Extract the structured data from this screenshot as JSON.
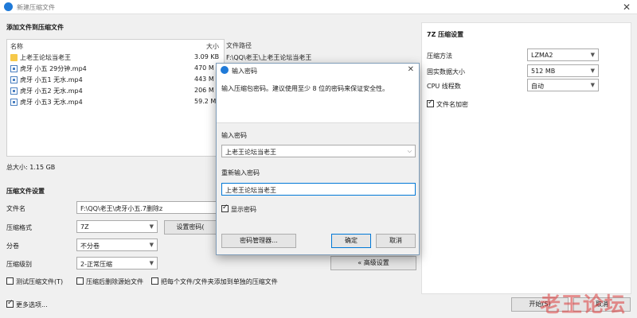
{
  "window": {
    "title": "新建压缩文件",
    "close": "✕"
  },
  "files_section": {
    "heading": "添加文件到压缩文件",
    "columns": [
      "名称",
      "大小",
      "文件路径"
    ],
    "rows": [
      {
        "name": "上老王论坛当老王",
        "size": "3.09 KB",
        "path": "F:\\QQ\\老王\\上老王论坛当老王",
        "type": "folder"
      },
      {
        "name": "虎牙 小五 29分钟.mp4",
        "size": "470 M",
        "path": "",
        "type": "video"
      },
      {
        "name": "虎牙 小五1 无水.mp4",
        "size": "443 M",
        "path": "",
        "type": "video"
      },
      {
        "name": "虎牙 小五2 无水.mp4",
        "size": "206 M",
        "path": "",
        "type": "video"
      },
      {
        "name": "虎牙 小五3 无水.mp4",
        "size": "59.2 M",
        "path": "",
        "type": "video"
      }
    ],
    "total": "总大小: 1.15 GB"
  },
  "settings": {
    "heading": "压缩文件设置",
    "filename_label": "文件名",
    "filename_value": "F:\\QQ\\老王\\虎牙小五.7删除z",
    "format_label": "压缩格式",
    "format_value": "7Z",
    "password_btn": "设置密码(",
    "split_label": "分卷",
    "split_value": "不分卷",
    "level_label": "压缩级别",
    "level_value": "2-正常压缩",
    "advanced_btn": "« 高级设置",
    "opt_test": "测试压缩文件(T)",
    "opt_delete": "压缩后删除源始文件",
    "opt_each": "把每个文件/文件夹添加到单独的压缩文件",
    "more_options": "更多选项...",
    "start_btn": "开始(S)",
    "cancel_btn": "取消"
  },
  "seven_z": {
    "heading": "7Z 压缩设置",
    "method_label": "压缩方法",
    "method_value": "LZMA2",
    "dict_label": "固实数据大小",
    "dict_value": "512 MB",
    "threads_label": "CPU 线程数",
    "threads_value": "自动",
    "encrypt_names": "文件名加密"
  },
  "dialog": {
    "title": "输入密码",
    "close": "✕",
    "hint": "输入压缩包密码。建议使用至少 8 位的密码来保证安全性。",
    "pwd_label": "输入密码",
    "pwd_value": "上老王论坛当老王",
    "repwd_label": "重新输入密码",
    "repwd_value": "上老王论坛当老王",
    "show_pwd": "显示密码",
    "manager_btn": "密码管理器...",
    "ok_btn": "确定",
    "cancel_btn": "取消"
  },
  "watermark": "老王论坛",
  "colors": {
    "accent": "#1f7ad8",
    "dialog_border": "#7f9db9",
    "focus_border": "#0078d7"
  }
}
